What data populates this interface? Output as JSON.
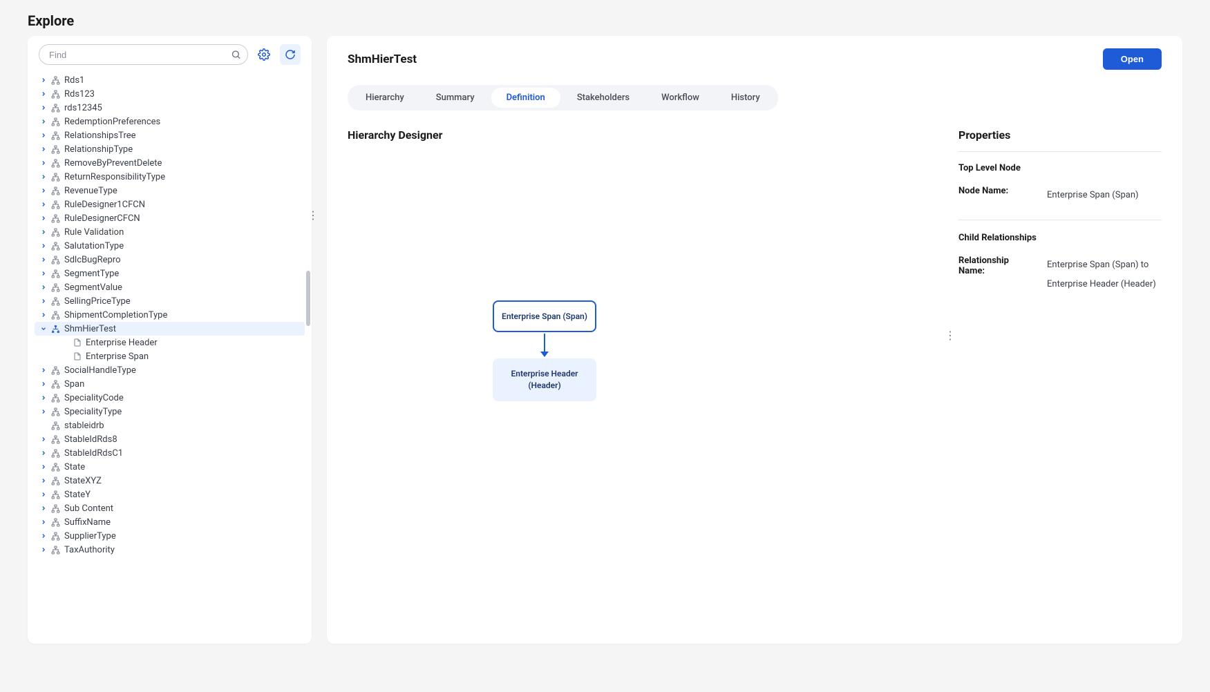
{
  "page_title": "Explore",
  "search": {
    "placeholder": "Find"
  },
  "tree": [
    {
      "label": "Rds1",
      "icon": "sitemap",
      "expandable": true
    },
    {
      "label": "Rds123",
      "icon": "sitemap",
      "expandable": true
    },
    {
      "label": "rds12345",
      "icon": "sitemap",
      "expandable": true
    },
    {
      "label": "RedemptionPreferences",
      "icon": "sitemap",
      "expandable": true
    },
    {
      "label": "RelationshipsTree",
      "icon": "sitemap",
      "expandable": true
    },
    {
      "label": "RelationshipType",
      "icon": "sitemap",
      "expandable": true
    },
    {
      "label": "RemoveByPreventDelete",
      "icon": "sitemap",
      "expandable": true
    },
    {
      "label": "ReturnResponsibilityType",
      "icon": "sitemap",
      "expandable": true
    },
    {
      "label": "RevenueType",
      "icon": "sitemap",
      "expandable": true
    },
    {
      "label": "RuleDesigner1CFCN",
      "icon": "sitemap",
      "expandable": true
    },
    {
      "label": "RuleDesignerCFCN",
      "icon": "sitemap",
      "expandable": true
    },
    {
      "label": "Rule Validation",
      "icon": "sitemap",
      "expandable": true
    },
    {
      "label": "SalutationType",
      "icon": "sitemap",
      "expandable": true
    },
    {
      "label": "SdlcBugRepro",
      "icon": "sitemap",
      "expandable": true
    },
    {
      "label": "SegmentType",
      "icon": "sitemap",
      "expandable": true
    },
    {
      "label": "SegmentValue",
      "icon": "sitemap",
      "expandable": true
    },
    {
      "label": "SellingPriceType",
      "icon": "sitemap",
      "expandable": true
    },
    {
      "label": "ShipmentCompletionType",
      "icon": "sitemap",
      "expandable": true
    },
    {
      "label": "ShmHierTest",
      "icon": "hierarchy",
      "expandable": true,
      "expanded": true,
      "selected": true,
      "children": [
        {
          "label": "Enterprise Header",
          "icon": "doc"
        },
        {
          "label": "Enterprise Span",
          "icon": "doc"
        }
      ]
    },
    {
      "label": "SocialHandleType",
      "icon": "sitemap",
      "expandable": true
    },
    {
      "label": "Span",
      "icon": "sitemap",
      "expandable": true
    },
    {
      "label": "SpecialityCode",
      "icon": "sitemap",
      "expandable": true
    },
    {
      "label": "SpecialityType",
      "icon": "sitemap",
      "expandable": true
    },
    {
      "label": "stableidrb",
      "icon": "sitemap",
      "expandable": false
    },
    {
      "label": "StableIdRds8",
      "icon": "sitemap",
      "expandable": true
    },
    {
      "label": "StableIdRdsC1",
      "icon": "sitemap",
      "expandable": true
    },
    {
      "label": "State",
      "icon": "sitemap",
      "expandable": true
    },
    {
      "label": "StateXYZ",
      "icon": "sitemap",
      "expandable": true
    },
    {
      "label": "StateY",
      "icon": "sitemap",
      "expandable": true
    },
    {
      "label": "Sub Content",
      "icon": "sitemap",
      "expandable": true
    },
    {
      "label": "SuffixName",
      "icon": "sitemap",
      "expandable": true
    },
    {
      "label": "SupplierType",
      "icon": "sitemap",
      "expandable": true
    },
    {
      "label": "TaxAuthority",
      "icon": "sitemap",
      "expandable": true
    }
  ],
  "main": {
    "title": "ShmHierTest",
    "open_label": "Open",
    "tabs": [
      "Hierarchy",
      "Summary",
      "Definition",
      "Stakeholders",
      "Workflow",
      "History"
    ],
    "active_tab": "Definition",
    "designer_title": "Hierarchy Designer",
    "nodes": {
      "parent": "Enterprise Span (Span)",
      "child_line1": "Enterprise Header",
      "child_line2": "(Header)"
    }
  },
  "properties": {
    "title": "Properties",
    "section1_title": "Top Level Node",
    "node_name_label": "Node Name:",
    "node_name_value": "Enterprise Span (Span)",
    "section2_title": "Child Relationships",
    "rel_name_label": "Relationship Name:",
    "rel_name_value": "Enterprise Span (Span) to Enterprise Header (Header)"
  }
}
